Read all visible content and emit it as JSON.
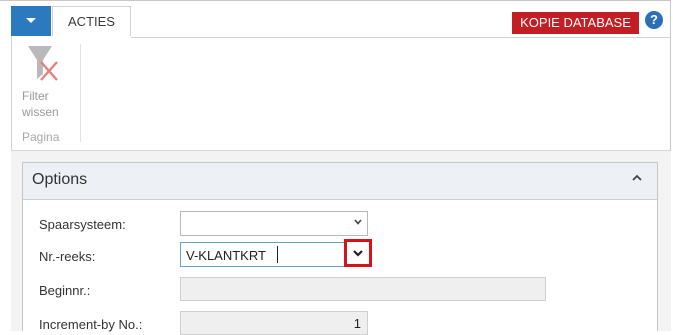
{
  "ribbon": {
    "tabs": [
      {
        "label": "ACTIES"
      }
    ],
    "environment_badge": "KOPIE DATABASE",
    "help_label": "?",
    "actions": [
      {
        "label_line1": "Filter",
        "label_line2": "wissen",
        "icon": "clear-filter-icon"
      }
    ],
    "group_label": "Pagina"
  },
  "options": {
    "title": "Options",
    "fields": [
      {
        "label": "Spaarsysteem:",
        "value": ""
      },
      {
        "label": "Nr.-reeks:",
        "value": "V-KLANTKRT"
      },
      {
        "label": "Beginnr.:",
        "value": ""
      },
      {
        "label": "Increment-by No.:",
        "value": "1"
      }
    ]
  },
  "colors": {
    "accent_blue": "#2b79bf",
    "badge_red": "#c41e25",
    "highlight_red": "#d4141b"
  }
}
